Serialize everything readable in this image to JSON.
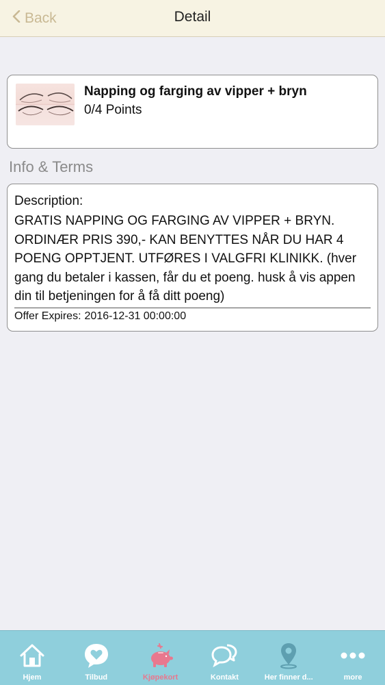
{
  "navbar": {
    "back_label": "Back",
    "title": "Detail"
  },
  "offer": {
    "title": "Napping og farging av vipper + bryn",
    "points": "0/4 Points"
  },
  "section": {
    "title": "Info & Terms"
  },
  "terms": {
    "description_label": "Description:",
    "description": "GRATIS NAPPING OG FARGING AV VIPPER + BRYN. ORDINÆR PRIS 390,- KAN BENYTTES NÅR DU HAR 4 POENG OPPTJENT. UTFØRES I VALGFRI KLINIKK. (hver gang du betaler i kassen, får du et poeng. husk å vis appen din til betjeningen for å få ditt poeng)",
    "expires_label": "Offer Expires:",
    "expires_value": "2016-12-31 00:00:00"
  },
  "tabbar": {
    "tabs": [
      {
        "label": "Hjem",
        "icon": "home-icon"
      },
      {
        "label": "Tilbud",
        "icon": "heart-bubble-icon"
      },
      {
        "label": "Kjøpekort",
        "icon": "piggy-bank-icon",
        "active": true
      },
      {
        "label": "Kontakt",
        "icon": "chat-icon"
      },
      {
        "label": "Her finner d...",
        "icon": "location-pin-icon"
      },
      {
        "label": "more",
        "icon": "more-icon"
      }
    ]
  },
  "colors": {
    "navbar_bg": "#f7f3e3",
    "back_tint": "#c9b994",
    "tabbar_bg": "#8fcfdc",
    "tab_active": "#e8788e",
    "tab_inactive": "#ffffff"
  }
}
